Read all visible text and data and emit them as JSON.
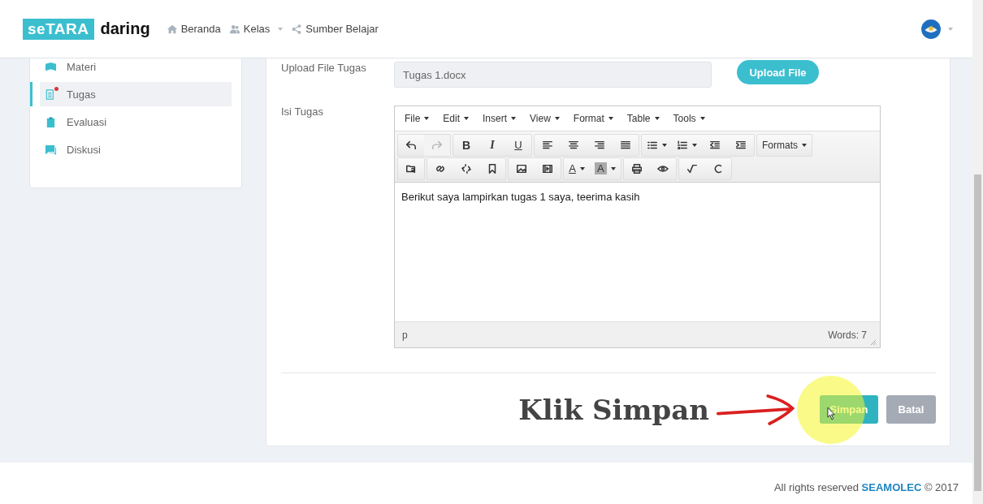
{
  "header": {
    "logo": {
      "highlight": "seTARA",
      "text": "daring"
    },
    "nav": [
      {
        "label": "Beranda",
        "dropdown": false
      },
      {
        "label": "Kelas",
        "dropdown": true
      },
      {
        "label": "Sumber Belajar",
        "dropdown": false
      }
    ]
  },
  "sidebar": {
    "items": [
      {
        "label": "Materi",
        "selected": false,
        "unread": false
      },
      {
        "label": "Tugas",
        "selected": true,
        "unread": true
      },
      {
        "label": "Evaluasi",
        "selected": false,
        "unread": false
      },
      {
        "label": "Diskusi",
        "selected": false,
        "unread": false
      }
    ]
  },
  "form": {
    "upload": {
      "label": "Upload File Tugas",
      "value": "Tugas 1.docx",
      "button": "Upload File"
    },
    "content": {
      "label": "Isi Tugas",
      "menu": [
        "File",
        "Edit",
        "Insert",
        "View",
        "Format",
        "Table",
        "Tools"
      ],
      "toolbar": [
        [
          [
            {
              "kind": "undo",
              "disabled": false
            },
            {
              "kind": "redo",
              "disabled": true
            }
          ],
          [
            {
              "kind": "bold",
              "label": "B"
            },
            {
              "kind": "italic",
              "label": "I"
            },
            {
              "kind": "underline",
              "label": "U"
            }
          ],
          [
            {
              "kind": "alignleft"
            },
            {
              "kind": "aligncenter"
            },
            {
              "kind": "alignright"
            },
            {
              "kind": "justify"
            }
          ],
          [
            {
              "kind": "bullist",
              "caret": true
            },
            {
              "kind": "numlist",
              "caret": true
            },
            {
              "kind": "outdent"
            },
            {
              "kind": "indent"
            }
          ],
          [
            {
              "kind": "dropdown",
              "label": "Formats",
              "caret": true
            }
          ]
        ],
        [
          [
            {
              "kind": "preview"
            }
          ],
          [
            {
              "kind": "link"
            },
            {
              "kind": "unlink"
            },
            {
              "kind": "bookmark"
            }
          ],
          [
            {
              "kind": "image"
            },
            {
              "kind": "media"
            }
          ],
          [
            {
              "kind": "forecolor",
              "label": "A",
              "caret": true
            },
            {
              "kind": "backcolor",
              "label": "A",
              "caret": true
            }
          ],
          [
            {
              "kind": "print"
            },
            {
              "kind": "eye"
            }
          ],
          [
            {
              "kind": "check"
            },
            {
              "kind": "code"
            }
          ]
        ]
      ],
      "text": "Berikut saya lampirkan tugas 1 saya, teerima kasih",
      "path": "p",
      "word_count": "Words: 7"
    }
  },
  "actions": [
    {
      "label": "Simpan",
      "kind": "primary"
    },
    {
      "label": "Batal",
      "kind": "secondary"
    }
  ],
  "annotation": "Klik Simpan",
  "footer": {
    "prefix": "All rights reserved",
    "brand": "SEAMOLEC",
    "suffix": "© 2017"
  }
}
